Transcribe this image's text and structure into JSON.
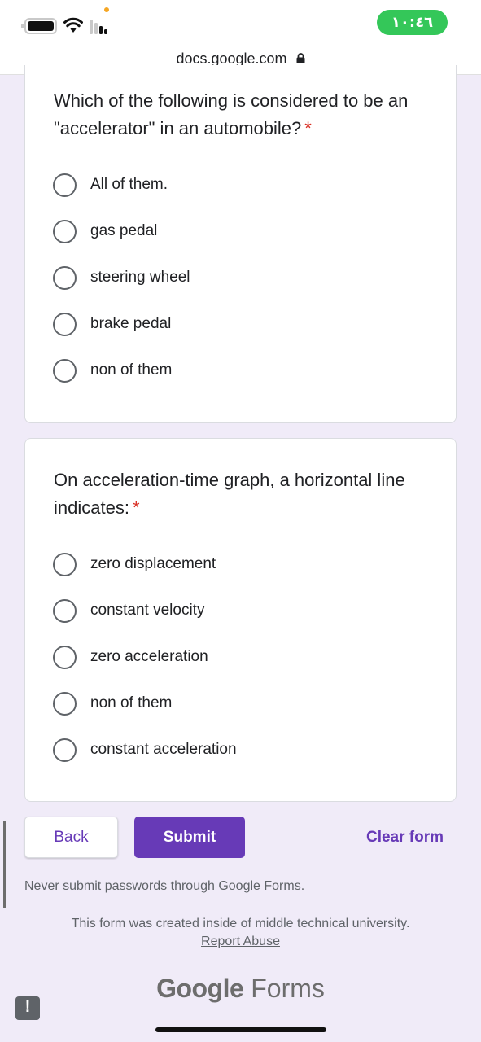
{
  "status_bar": {
    "time": "١٠:٤٦",
    "colors": {
      "clock_pill": "#34c759",
      "privacy_dot": "#f5a623"
    },
    "icons": [
      "battery-icon",
      "wifi-icon",
      "cellular-signal-icon"
    ]
  },
  "browser": {
    "url": "docs.google.com",
    "url_icon": "lock-icon"
  },
  "questions": [
    {
      "text": "Which of the following is considered to be an \"accelerator\" in an automobile?",
      "required_mark": "*",
      "options": [
        "All of them.",
        "gas pedal",
        "steering wheel",
        "brake pedal",
        "non of them"
      ]
    },
    {
      "text": "On acceleration-time graph, a horizontal line indicates:",
      "required_mark": "*",
      "options": [
        "zero displacement",
        "constant velocity",
        "zero acceleration",
        "non of them",
        "constant acceleration"
      ]
    }
  ],
  "actions": {
    "back": "Back",
    "submit": "Submit",
    "clear": "Clear form"
  },
  "footer": {
    "warning": "Never submit passwords through Google Forms.",
    "created": "This form was created inside of middle technical university.",
    "report": "Report Abuse",
    "logo_brand": "Google",
    "logo_product": "Forms",
    "report_fab": "!"
  },
  "theme": {
    "accent": "#673ab7",
    "background": "#f0ebf8",
    "required": "#d93025"
  }
}
